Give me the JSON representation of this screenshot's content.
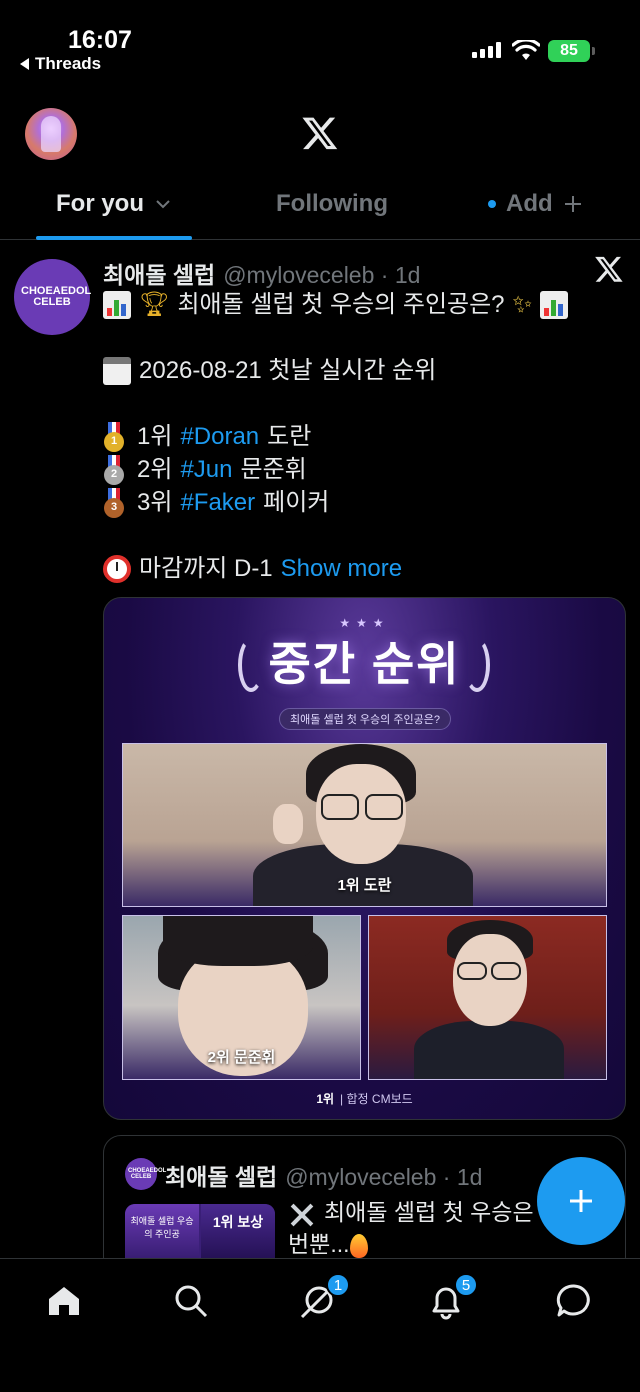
{
  "status_bar": {
    "time": "16:07",
    "back_app": "Threads",
    "battery": "85"
  },
  "tabs": [
    {
      "label": "For you"
    },
    {
      "label": "Following"
    },
    {
      "label": "Add"
    }
  ],
  "tweet": {
    "author_name": "최애돌 셀럽",
    "handle": "@myloveceleb",
    "time": "1d",
    "avatar_text": "CHOEAEDOL CELEB",
    "title": "최애돌 셀럽 첫 우승의 주인공은?",
    "date_line": "2026-08-21 첫날 실시간 순위",
    "rankings": [
      {
        "rank": "1위",
        "hashtag": "#Doran",
        "name": "도란",
        "medal": "1"
      },
      {
        "rank": "2위",
        "hashtag": "#Jun",
        "name": "문준휘",
        "medal": "2"
      },
      {
        "rank": "3위",
        "hashtag": "#Faker",
        "name": "페이커",
        "medal": "3"
      }
    ],
    "deadline": "마감까지 D-1",
    "show_more": "Show more"
  },
  "media": {
    "title": "중간 순위",
    "subtitle": "최애돌 셀럽 첫 우승의 주인공은?",
    "photo1_caption": "1위 도란",
    "photo2_caption": "2위 문준휘",
    "footer_rank": "1위",
    "footer_text": "합정 CM보드"
  },
  "quote": {
    "author_name": "최애돌 셀럽",
    "handle": "@myloveceleb",
    "time": "1d",
    "avatar_text": "CHOEAEDOL CELEB",
    "thumb_a": "최애돌 셀럽 우승의 주인공",
    "thumb_b": "1위 보상",
    "text_line1": "최애돌 셀럽 첫 우승은",
    "text_line2": "번뿐..."
  },
  "nav": {
    "messages_badge": "1",
    "notifications_badge": "5"
  },
  "colors": {
    "accent": "#1d9bf0",
    "background": "#000000",
    "muted": "#71767b"
  }
}
